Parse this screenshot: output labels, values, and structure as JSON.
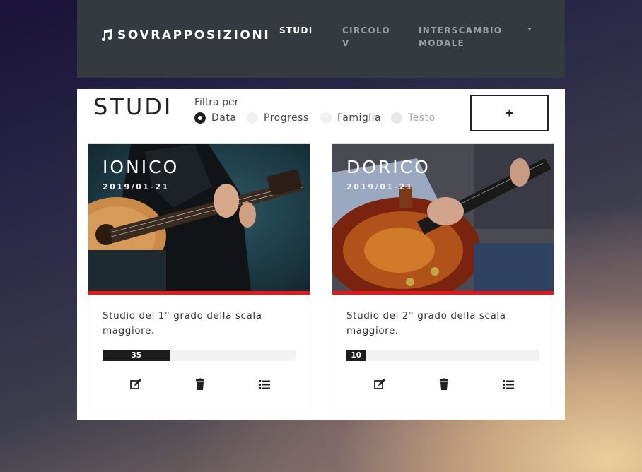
{
  "navbar": {
    "brand": "SOVRAPPOSIZIONI",
    "items": [
      {
        "label": "STUDI",
        "active": true
      },
      {
        "label": "CIRCOLO V",
        "line1": "CIRCOLO",
        "line2": "V",
        "active": false
      },
      {
        "label": "INTERSCAMBIO MODALE",
        "line1": "INTERSCAMBIO",
        "line2": "MODALE",
        "active": false
      }
    ]
  },
  "page": {
    "title": "STUDI",
    "filter_label": "Filtra per",
    "filters": [
      {
        "label": "Data",
        "checked": true,
        "disabled": false
      },
      {
        "label": "Progress",
        "checked": false,
        "disabled": false
      },
      {
        "label": "Famiglia",
        "checked": false,
        "disabled": false
      },
      {
        "label": "Testo",
        "checked": false,
        "disabled": true
      }
    ],
    "add_label": "+"
  },
  "cards": [
    {
      "title": "IONICO",
      "date": "2019/01-21",
      "description": "Studio del 1° grado della scala maggiore.",
      "progress": 35,
      "accent": "#e8151b",
      "actions": [
        "edit-icon",
        "trash-icon",
        "list-icon"
      ]
    },
    {
      "title": "DORICO",
      "date": "2019/01-21",
      "description": "Studio del 2° grado della scala maggiore.",
      "progress": 10,
      "accent": "#e8151b",
      "actions": [
        "edit-icon",
        "trash-icon",
        "list-icon"
      ]
    }
  ],
  "colors": {
    "navbar_bg": "#343a40",
    "accent_red": "#e8151b",
    "progress_fill": "#1c1c1c"
  }
}
